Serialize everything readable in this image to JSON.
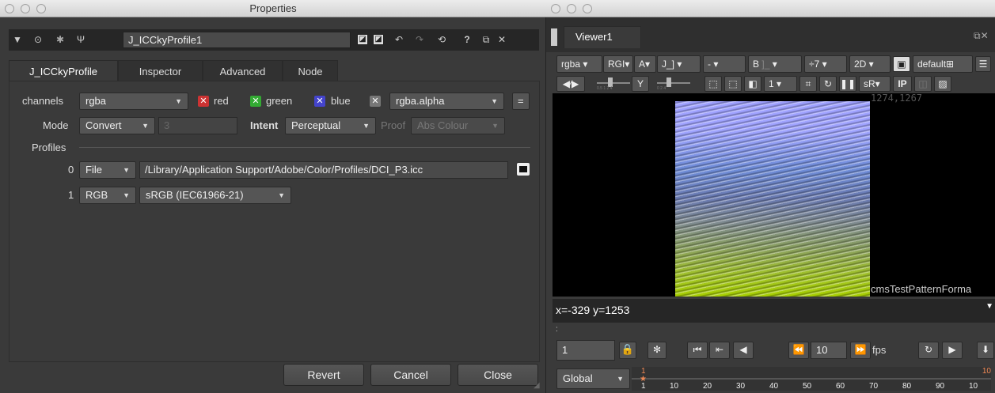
{
  "left_window": {
    "title": "Properties",
    "node_name": "J_ICCkyProfile1",
    "help_label": "?",
    "tabs": [
      "J_ICCkyProfile",
      "Inspector",
      "Advanced",
      "Node"
    ],
    "channels": {
      "label": "channels",
      "value": "rgba",
      "red": "red",
      "green": "green",
      "blue": "blue",
      "alpha_value": "rgba.alpha",
      "equals": "="
    },
    "mode": {
      "label": "Mode",
      "value": "Convert",
      "number": "3",
      "intent_label": "Intent",
      "intent_value": "Perceptual",
      "proof_label": "Proof",
      "proof_value": "Abs Colour"
    },
    "profiles": {
      "label": "Profiles",
      "rows": [
        {
          "index": "0",
          "type": "File",
          "value": "/Library/Application Support/Adobe/Color/Profiles/DCI_P3.icc"
        },
        {
          "index": "1",
          "type": "RGB",
          "value": "sRGB (IEC61966-21)"
        }
      ]
    },
    "buttons": {
      "revert": "Revert",
      "cancel": "Cancel",
      "close": "Close"
    }
  },
  "right_window": {
    "tab": "Viewer1",
    "toolbar1": {
      "channels": "rgba",
      "rgb": "RGI",
      "a": "A",
      "a_value": "J_]",
      "minus": "-",
      "b": "B",
      "b_value": "]_",
      "gain": "÷7",
      "view_mode": "2D",
      "lut": "default"
    },
    "toolbar2": {
      "y_label": "Y",
      "frame": "1",
      "srgb": "sR",
      "ip": "IP",
      "gain_ticks": "0.5 1 2 4",
      "gamma_ticks": "0 2 4"
    },
    "viewport": {
      "resolution": "1274,1267",
      "format": "cmsTestPatternForma"
    },
    "coords": "x=-329 y=1253",
    "playback": {
      "frame": "1",
      "step": "10",
      "fps_label": "fps"
    },
    "timeline": {
      "scope": "Global",
      "start": "1",
      "end": "10",
      "ticks": [
        "1",
        "10",
        "20",
        "30",
        "40",
        "50",
        "60",
        "70",
        "80",
        "90",
        "10"
      ]
    }
  }
}
